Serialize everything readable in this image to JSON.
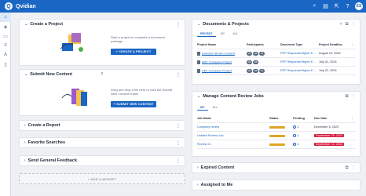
{
  "app": {
    "name": "Qvidian",
    "logo_letter": "Q",
    "user_initials": "ES"
  },
  "topbar_icons": [
    "search-icon",
    "book-icon",
    "open-icon",
    "help-icon"
  ],
  "sidebar_icons": [
    "home-icon",
    "layers-icon",
    "clipboard-icon",
    "list-icon",
    "translate-icon",
    "document-icon"
  ],
  "left": {
    "create_project": {
      "title": "Create a Project",
      "desc": "Start a project to complete a document package",
      "button": "+ CREATE A PROJECT"
    },
    "submit_content": {
      "title": "Submit New Content",
      "desc": "Drag and drop a file here or click the Submit New Content button",
      "button": "+ SUBMIT NEW CONTENT"
    },
    "create_report": {
      "title": "Create a Report"
    },
    "favorite_searches": {
      "title": "Favorite Searches"
    },
    "general_feedback": {
      "title": "Send General Feedback"
    },
    "add_widget": "+ ADD A WIDGET"
  },
  "documents": {
    "title": "Documents & Projects",
    "tabs": [
      "RECENT",
      "MY",
      "ALL"
    ],
    "columns": [
      "Project Name",
      "Participants",
      "Document Type",
      "Project Deadline"
    ],
    "rows": [
      {
        "name": "Selection Brown Content",
        "participants": [
          "CR",
          "GB",
          "SS"
        ],
        "type": "RFP Response/Higher Ed...",
        "deadline": "August 13, 2024"
      },
      {
        "name": "ABC Company Project",
        "participants": [
          "CR",
          "GB"
        ],
        "type": "RFP Response/Higher Ed...",
        "deadline": "July 31, 2024"
      },
      {
        "name": "DEF Company Project",
        "participants": [
          "CR",
          "GB",
          "SS"
        ],
        "type": "RFP Response/Higher Ed...",
        "deadline": "July 22, 2024"
      }
    ]
  },
  "review_jobs": {
    "title": "Manage Content Review Jobs",
    "tabs": [
      "MY",
      "ALL"
    ],
    "columns": [
      "Job Name",
      "Status",
      "Pending",
      "Due Date"
    ],
    "rows": [
      {
        "name": "Company review",
        "status_pct": 0.7,
        "pending": "1",
        "due": "December 6, 2023",
        "overdue": false
      },
      {
        "name": "Untitled Review Job",
        "status_pct": 0.7,
        "pending": "1",
        "due": "September 25, 2023",
        "overdue": true
      },
      {
        "name": "Review 21",
        "status_pct": 0.7,
        "pending": "1",
        "due": "September 13, 2023",
        "overdue": true
      }
    ]
  },
  "expired_content": {
    "title": "Expired Content"
  },
  "assigned_to_me": {
    "title": "Assigned to Me"
  },
  "colors": {
    "brand": "#1a66c4",
    "status": "#e0a526",
    "overdue": "#d4163b"
  }
}
